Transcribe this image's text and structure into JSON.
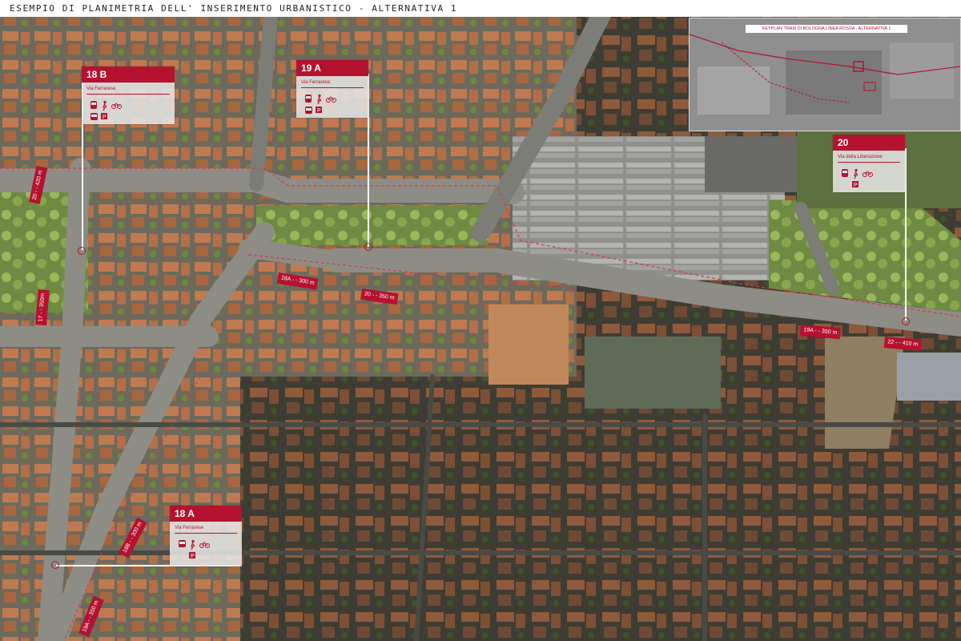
{
  "header": {
    "title": "ESEMPIO DI PLANIMETRIA DELL' INSERIMENTO URBANISTICO - ALTERNATIVA 1"
  },
  "keyplan": {
    "title": "KEYPLAN TRAM DI BOLOGNA LINEA ROSSA - ALTERNATIVA 1"
  },
  "stops": [
    {
      "id": "18B",
      "name": "18 B",
      "street": "Via Ferrarese"
    },
    {
      "id": "19A",
      "name": "19 A",
      "street": "Via Ferrarese"
    },
    {
      "id": "20",
      "name": "20",
      "street": "Via della Liberazione"
    },
    {
      "id": "18A",
      "name": "18 A",
      "street": "Via Ferrarese"
    }
  ],
  "segments": {
    "s1": "20 - - 420 m",
    "s2": "17 - - 350m",
    "s3": "18A - - 300 m",
    "s4": "20 - - 350 m",
    "s5": "19A - - 350 m",
    "s6": "22 - - 410 m",
    "s7": "18B - - 300 m",
    "s8": "19A - - 350 m",
    "s9": "17 - - 350 m"
  },
  "icons": [
    "tram-icon",
    "bus-icon",
    "pedestrian-icon",
    "bicycle-icon",
    "parking-icon"
  ],
  "colors": {
    "accent": "#b4122f",
    "road": "#8d8d86",
    "building": "#a8603a"
  }
}
